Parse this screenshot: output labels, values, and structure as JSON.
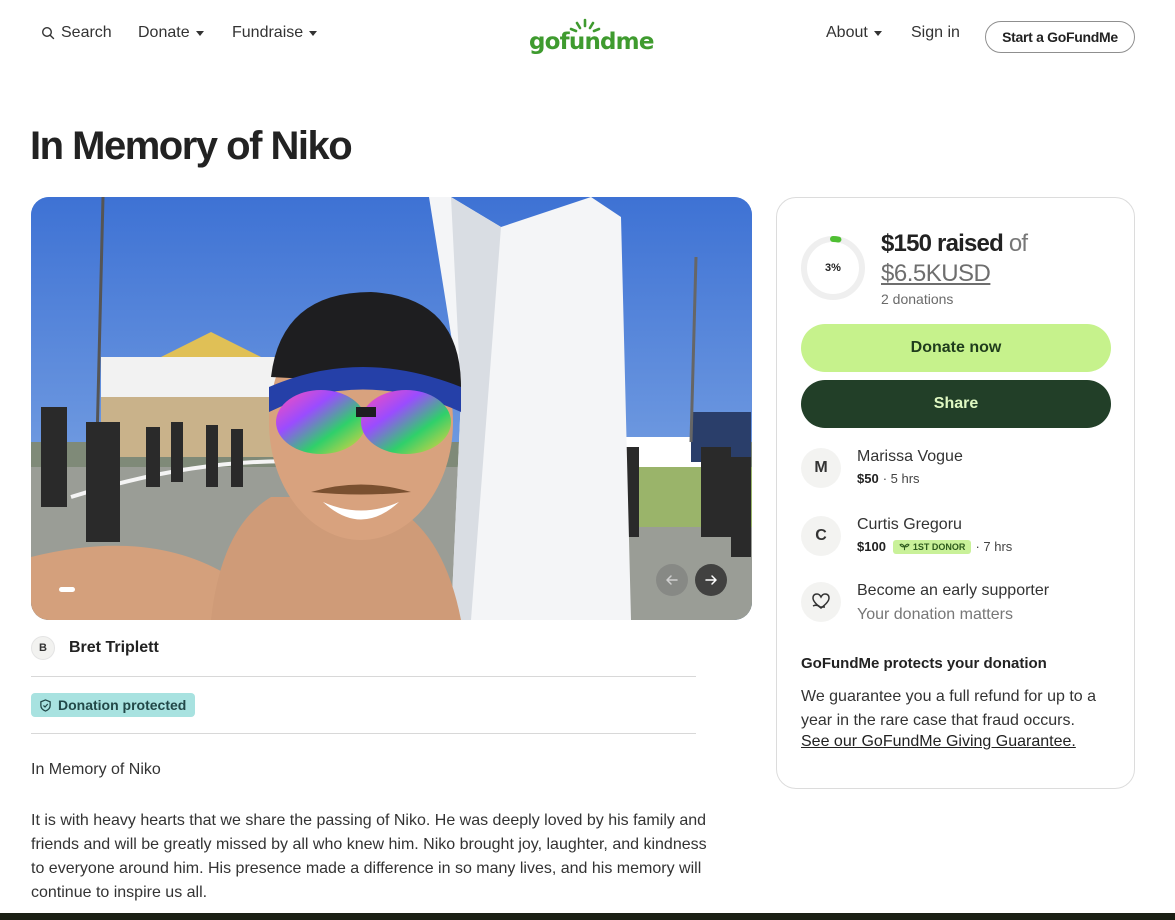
{
  "header": {
    "search_label": "Search",
    "donate_label": "Donate",
    "fundraise_label": "Fundraise",
    "logo_text": "gofundme",
    "about_label": "About",
    "signin_label": "Sign in",
    "start_label": "Start a GoFundMe"
  },
  "campaign": {
    "title": "In Memory of Niko",
    "organizer_initial": "B",
    "organizer_name": "Bret Triplett",
    "protected_badge": "Donation protected",
    "story_title": "In Memory of Niko",
    "story_body": "It is with heavy hearts that we share the passing of Niko. He was deeply loved by his family and friends and will be greatly missed by all who knew him. Niko brought joy, laughter, and kindness to everyone around him. His presence made a difference in so many lives, and his memory will continue to inspire us all."
  },
  "carousel": {
    "prev_icon": "arrow-left-icon",
    "next_icon": "arrow-right-icon"
  },
  "progress": {
    "percent_label": "3%",
    "fraction": 0.03,
    "raised": "$150 raised",
    "of": "of",
    "goal": "$6.5KUSD",
    "donations": "2 donations"
  },
  "actions": {
    "donate": "Donate now",
    "share": "Share"
  },
  "donors": [
    {
      "initial": "M",
      "name": "Marissa Vogue",
      "amount": "$50",
      "time": "· 5 hrs"
    },
    {
      "initial": "C",
      "name": "Curtis Gregoru",
      "amount": "$100",
      "badge": "1ST DONOR",
      "time": "· 7 hrs"
    }
  ],
  "early": {
    "title": "Become an early supporter",
    "subtitle": "Your donation matters"
  },
  "guarantee": {
    "heading": "GoFundMe protects your donation",
    "body": "We guarantee you a full refund for up to a year in the rare case that fraud occurs.",
    "link": "See our GoFundMe Giving Guarantee."
  },
  "colors": {
    "brand_green": "#3f9b2f",
    "donate_button": "#c6f28c",
    "share_button": "#223f28",
    "protected_badge": "#a8e2e0"
  }
}
